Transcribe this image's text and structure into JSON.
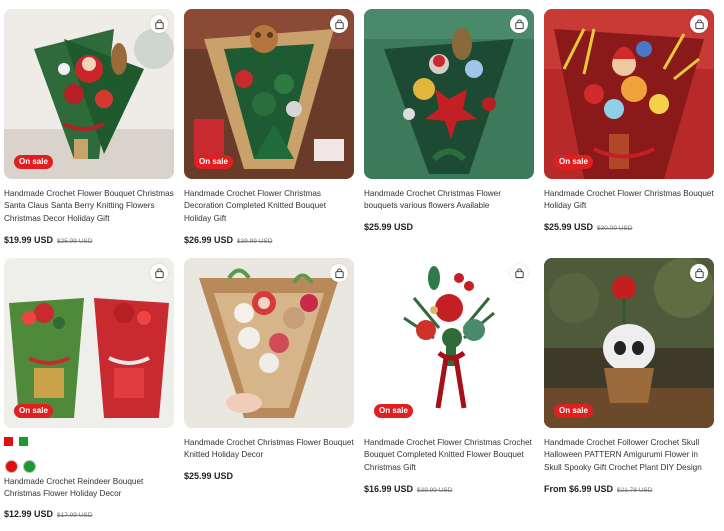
{
  "colors": {
    "sale_badge": "#e02020",
    "text": "#222222",
    "old_price": "#777777"
  },
  "products": [
    {
      "title": "Handmade Crochet Flower Bouquet Christmas Santa Claus Santa Berry Knitting Flowers Christmas Decor Holiday Gift",
      "price": "$19.99 USD",
      "old_price": "$25.99 USD",
      "badge": "On sale"
    },
    {
      "title": "Handmade Crochet Flower Christmas Decoration Completed Knitted Bouquet Holiday Gift",
      "price": "$26.99 USD",
      "old_price": "$39.99 USD",
      "badge": "On sale"
    },
    {
      "title": "Handmade Crochet Christmas Flower bouquets various flowers Available",
      "price": "$25.99 USD",
      "old_price": "",
      "badge": ""
    },
    {
      "title": "Handmade Crochet Flower Christmas Bouquet Holiday Gift",
      "price": "$25.99 USD",
      "old_price": "$30.00 USD",
      "badge": "On sale"
    },
    {
      "title": "Handmade Crochet Reindeer Bouquet Christmas Flower Holiday Decor",
      "price": "$12.99 USD",
      "old_price": "$17.99 USD",
      "badge": "On sale",
      "swatches": [
        "#e01010",
        "#1c9a2e"
      ]
    },
    {
      "title": "Handmade Crochet Christmas Flower Bouquet Knitted Holiday Decor",
      "price": "$25.99 USD",
      "old_price": "",
      "badge": ""
    },
    {
      "title": "Handmade Crochet Flower Christmas Crochet Bouquet Completed Knitted Flower Bouquet Christmas Gift",
      "price": "$16.99 USD",
      "old_price": "$39.99 USD",
      "badge": "On sale"
    },
    {
      "title": "Handmade Crochet Follower Crochet Skull Halloween PATTERN Amigurumi Flower in Skull Spooky Gift Crochet Plant DIY Design",
      "price": "From $6.99 USD",
      "old_price": "$21.78 USD",
      "badge": "On sale"
    }
  ]
}
